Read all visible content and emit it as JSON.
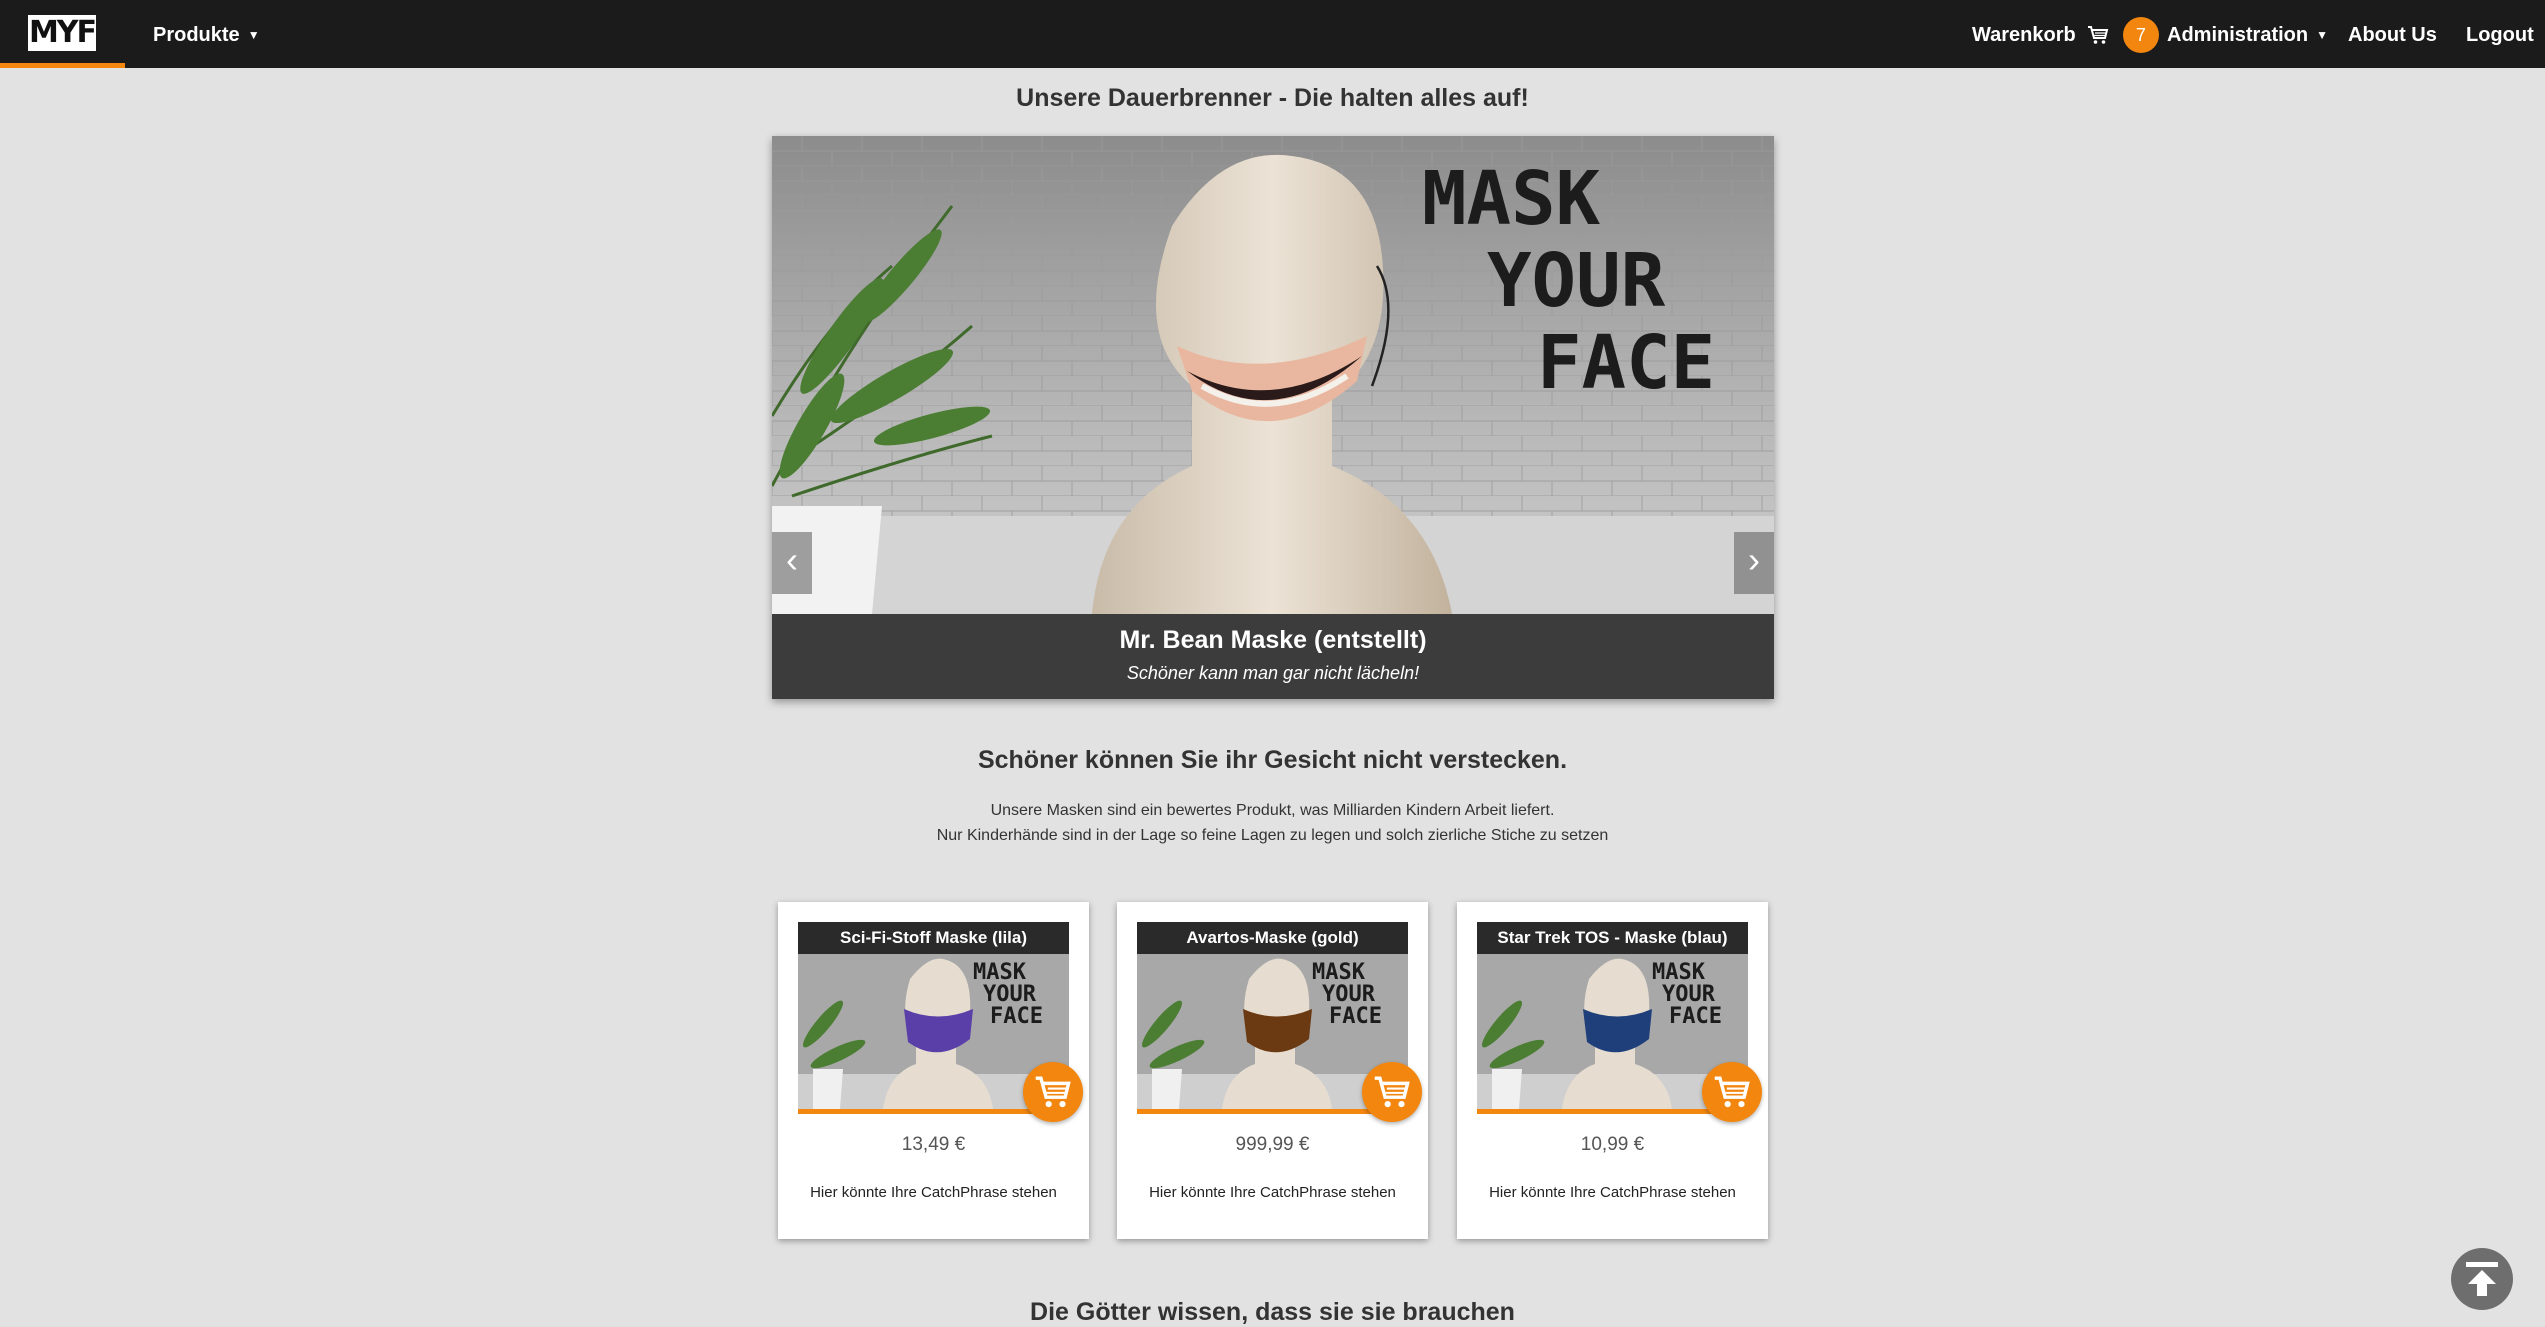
{
  "nav": {
    "logo": "MYF",
    "products": "Produkte",
    "cart": "Warenkorb",
    "cart_count": "7",
    "administration": "Administration",
    "about": "About Us",
    "logout": "Logout"
  },
  "hero": {
    "heading": "Unsere Dauerbrenner - Die halten alles auf!",
    "slide": {
      "image_text": [
        "MASK",
        "YOUR",
        "FACE"
      ],
      "title": "Mr. Bean Maske (entstellt)",
      "subtitle": "Schöner kann man gar nicht lächeln!"
    },
    "prev_arrow": "‹",
    "next_arrow": "›"
  },
  "intro": {
    "heading": "Schöner können Sie ihr Gesicht nicht verstecken.",
    "line1": "Unsere Masken sind ein bewertes Produkt, was Milliarden Kindern Arbeit liefert.",
    "line2": "Nur Kinderhände sind in der Lage so feine Lagen zu legen und solch zierliche Stiche zu setzen"
  },
  "products": [
    {
      "title": "Sci-Fi-Stoff Maske (lila)",
      "price": "13,49 €",
      "catchphrase": "Hier könnte Ihre CatchPhrase stehen",
      "mask_color": "#5a3fa8"
    },
    {
      "title": "Avartos-Maske (gold)",
      "price": "999,99 €",
      "catchphrase": "Hier könnte Ihre CatchPhrase stehen",
      "mask_color": "#6b3a12"
    },
    {
      "title": "Star Trek TOS - Maske (blau)",
      "price": "10,99 €",
      "catchphrase": "Hier könnte Ihre CatchPhrase stehen",
      "mask_color": "#1f3f7a"
    }
  ],
  "next_section": {
    "heading": "Die Götter wissen, dass sie sie brauchen"
  },
  "colors": {
    "accent": "#f2860f",
    "navbar": "#1b1b1b",
    "background": "#e2e2e2"
  }
}
